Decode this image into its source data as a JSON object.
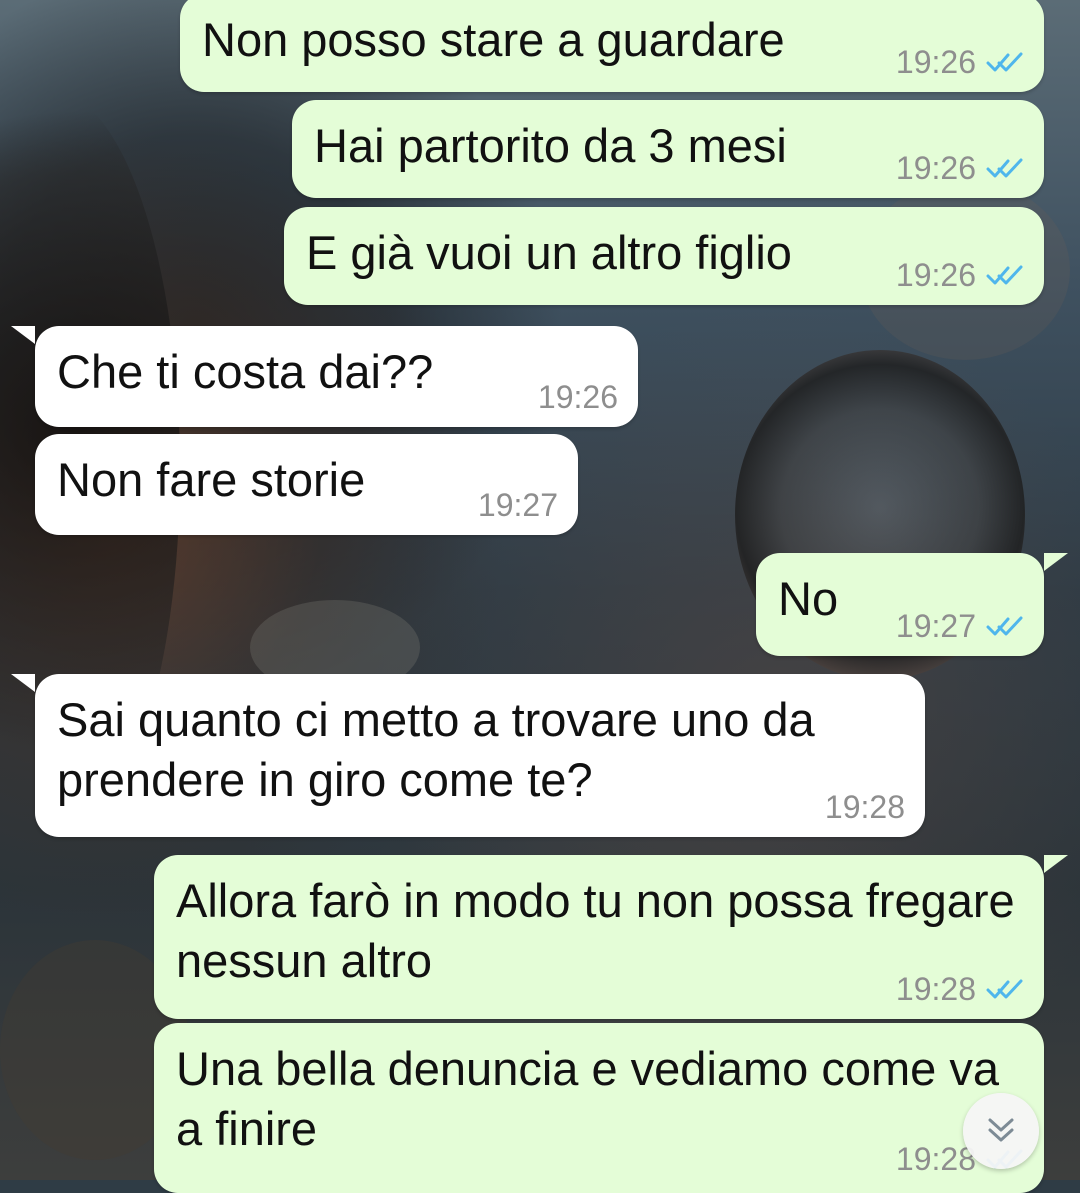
{
  "messages": [
    {
      "direction": "outgoing",
      "text": "Non posso stare a guardare",
      "time": "19:26",
      "status": "read"
    },
    {
      "direction": "outgoing",
      "text": "Hai partorito da 3 mesi",
      "time": "19:26",
      "status": "read"
    },
    {
      "direction": "outgoing",
      "text": "E già vuoi un altro figlio",
      "time": "19:26",
      "status": "read"
    },
    {
      "direction": "incoming",
      "text": "Che ti costa dai??",
      "time": "19:26"
    },
    {
      "direction": "incoming",
      "text": "Non fare storie",
      "time": "19:27"
    },
    {
      "direction": "outgoing",
      "text": "No",
      "time": "19:27",
      "status": "read"
    },
    {
      "direction": "incoming",
      "text": "Sai quanto ci metto a trovare uno da prendere in giro come te?",
      "time": "19:28"
    },
    {
      "direction": "outgoing",
      "text": "Allora farò in modo tu non possa fregare nessun altro",
      "time": "19:28",
      "status": "read"
    },
    {
      "direction": "outgoing",
      "text": "Una bella denuncia e vediamo come va a finire",
      "time": "19:28",
      "status": "read"
    }
  ],
  "icons": {
    "read_receipt": "double-check-icon",
    "scroll_down": "double-chevron-down-icon"
  },
  "colors": {
    "outgoing_bubble": "#e4fdd7",
    "incoming_bubble": "#ffffff",
    "read_ticks": "#4fb6ec",
    "timestamp": "#8e8e8e"
  }
}
